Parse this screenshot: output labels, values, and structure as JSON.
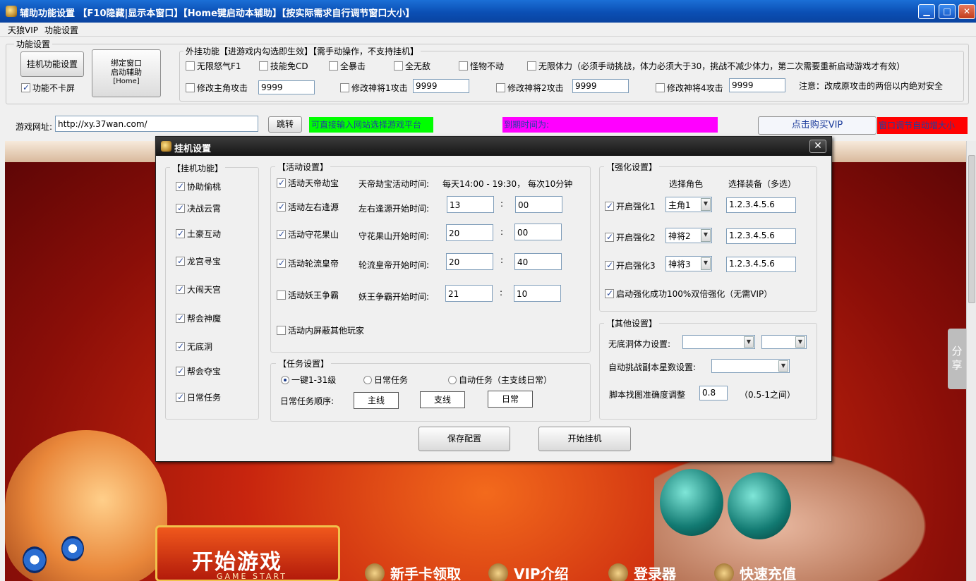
{
  "window": {
    "title": "辅助功能设置  【F10隐藏|显示本窗口】【Home键启动本辅助】【按实际需求自行调节窗口大小】",
    "min": "▁",
    "max": "□",
    "close": "✕"
  },
  "menu": {
    "items": [
      "天狼VIP",
      "功能设置"
    ]
  },
  "func_settings": {
    "legend": "功能设置",
    "hang_button": "挂机功能设置",
    "bind_button": [
      "绑定窗口",
      "启动辅助",
      "[Home]"
    ],
    "no_lag": {
      "label": "功能不卡屏",
      "checked": true
    }
  },
  "plugin": {
    "legend": "外挂功能【进游戏内勾选即生效】【需手动操作，不支持挂机】",
    "row1": [
      {
        "label": "无限怒气F1",
        "checked": false
      },
      {
        "label": "技能免CD",
        "checked": false
      },
      {
        "label": "全暴击",
        "checked": false
      },
      {
        "label": "全无敌",
        "checked": false
      },
      {
        "label": "怪物不动",
        "checked": false
      },
      {
        "label": "无限体力（必须手动挑战，体力必须大于30，挑战不减少体力，第二次需要重新启动游戏才有效）",
        "checked": false
      }
    ],
    "row2": [
      {
        "label": "修改主角攻击",
        "value": "9999",
        "checked": false
      },
      {
        "label": "修改神将1攻击",
        "value": "9999",
        "checked": false
      },
      {
        "label": "修改神将2攻击",
        "value": "9999",
        "checked": false
      },
      {
        "label": "修改神将4攻击",
        "value": "9999",
        "checked": false
      }
    ],
    "note": "注意：改成原攻击的两倍以内绝对安全"
  },
  "url_bar": {
    "label": "游戏网址:",
    "value": "http://xy.37wan.com/",
    "jump": "跳转",
    "hint": "可直接输入网站选择游戏平台",
    "expire": "到期时间为:",
    "buy_vip": "点击购买VIP",
    "red_label": "窗口调节自动增大小"
  },
  "colors": {
    "hint_bg": "#00ff00",
    "expire_bg": "#ff00ff",
    "red_bg": "#ff0000"
  },
  "game": {
    "start_text": "开始游戏",
    "start_sub": "GAME START",
    "menu": [
      "新手卡领取",
      "VIP介绍",
      "登录器",
      "快速充值"
    ],
    "share": [
      "分",
      "享"
    ]
  },
  "dialog": {
    "title": "挂机设置",
    "close": "✕",
    "hang_legend": "【挂机功能】",
    "hang_items": [
      {
        "label": "协助偷桃",
        "checked": true
      },
      {
        "label": "决战云霄",
        "checked": true
      },
      {
        "label": "土豪互动",
        "checked": true
      },
      {
        "label": "龙宫寻宝",
        "checked": true
      },
      {
        "label": "大闹天宫",
        "checked": true
      },
      {
        "label": "帮会神魔",
        "checked": true
      },
      {
        "label": "无底洞",
        "checked": true
      },
      {
        "label": "帮会夺宝",
        "checked": true
      },
      {
        "label": "日常任务",
        "checked": true
      }
    ],
    "activity_legend": "【活动设置】",
    "activity_top": {
      "label": "活动天帝劫宝",
      "checked": true,
      "time_label": "天帝劫宝活动时间:",
      "time_text": "每天14:00 - 19:30， 每次10分钟"
    },
    "activities": [
      {
        "label": "活动左右逢源",
        "checked": true,
        "time_label": "左右逢源开始时间:",
        "hour": "13",
        "min": "00"
      },
      {
        "label": "活动守花果山",
        "checked": true,
        "time_label": "守花果山开始时间:",
        "hour": "20",
        "min": "00"
      },
      {
        "label": "活动轮流皇帝",
        "checked": true,
        "time_label": "轮流皇帝开始时间:",
        "hour": "20",
        "min": "40"
      },
      {
        "label": "活动妖王争霸",
        "checked": false,
        "time_label": "妖王争霸开始时间:",
        "hour": "21",
        "min": "10"
      }
    ],
    "colon": ":",
    "block_players": {
      "label": "活动内屏蔽其他玩家",
      "checked": false
    },
    "task_legend": "【任务设置】",
    "task_radios": [
      {
        "label": "一键1-31级",
        "selected": true
      },
      {
        "label": "日常任务",
        "selected": false
      },
      {
        "label": "自动任务（主支线日常）",
        "selected": false
      }
    ],
    "task_order_label": "日常任务顺序:",
    "task_order": [
      "主线",
      "支线",
      "日常"
    ],
    "strengthen_legend": "【强化设置】",
    "col_role": "选择角色",
    "col_equip": "选择装备（多选）",
    "strengthen": [
      {
        "label": "开启强化1",
        "checked": true,
        "role": "主角1",
        "equip": "1.2.3.4.5.6"
      },
      {
        "label": "开启强化2",
        "checked": true,
        "role": "神将2",
        "equip": "1.2.3.4.5.6"
      },
      {
        "label": "开启强化3",
        "checked": true,
        "role": "神将3",
        "equip": "1.2.3.4.5.6"
      }
    ],
    "double_strengthen": {
      "label": "启动强化成功100%双倍强化（无需VIP）",
      "checked": true
    },
    "other_legend": "【其他设置】",
    "stamina_label": "无底洞体力设置:",
    "stars_label": "自动挑战副本星数设置:",
    "accuracy_label": "脚本找图准确度调整",
    "accuracy_value": "0.8",
    "accuracy_hint": "（0.5-1之间）",
    "save": "保存配置",
    "start": "开始挂机"
  }
}
